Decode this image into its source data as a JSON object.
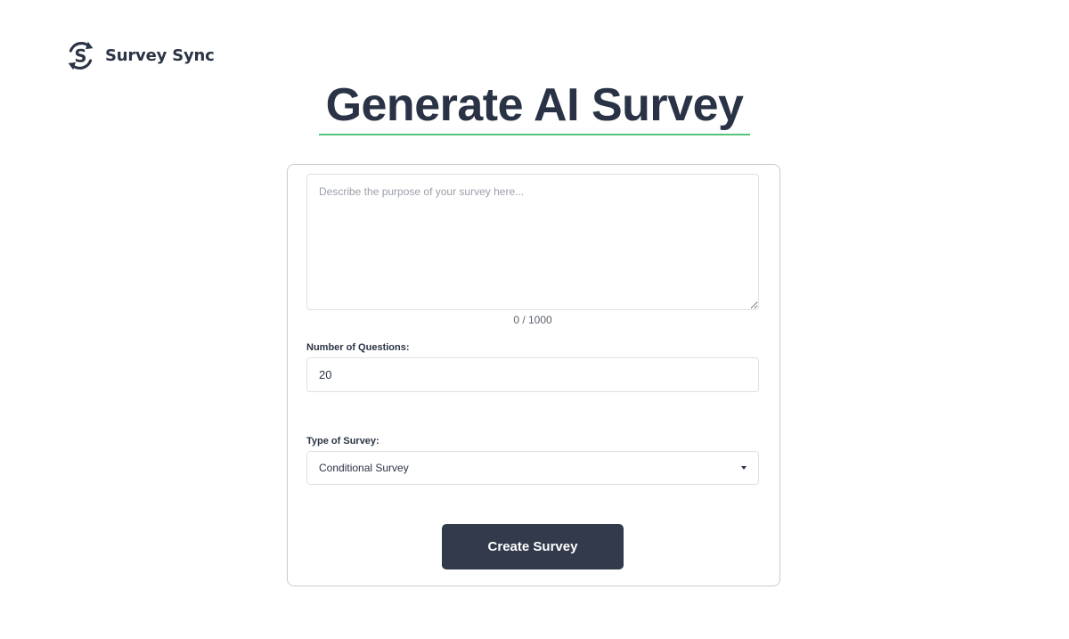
{
  "brand": {
    "name": "Survey Sync",
    "logo_icon": "sync-s-logo-icon"
  },
  "page": {
    "title": "Generate AI Survey",
    "underline_color": "#56c47a"
  },
  "form": {
    "purpose": {
      "value": "",
      "placeholder": "Describe the purpose of your survey here...",
      "char_count": "0 / 1000"
    },
    "questions": {
      "label": "Number of Questions:",
      "value": "20"
    },
    "survey_type": {
      "label": "Type of Survey:",
      "selected": "Conditional Survey",
      "icon": "chevron-down-icon"
    },
    "submit_label": "Create Survey"
  },
  "colors": {
    "text_dark": "#2a3346",
    "button_bg": "#323a4b",
    "accent_green": "#56c47a"
  }
}
